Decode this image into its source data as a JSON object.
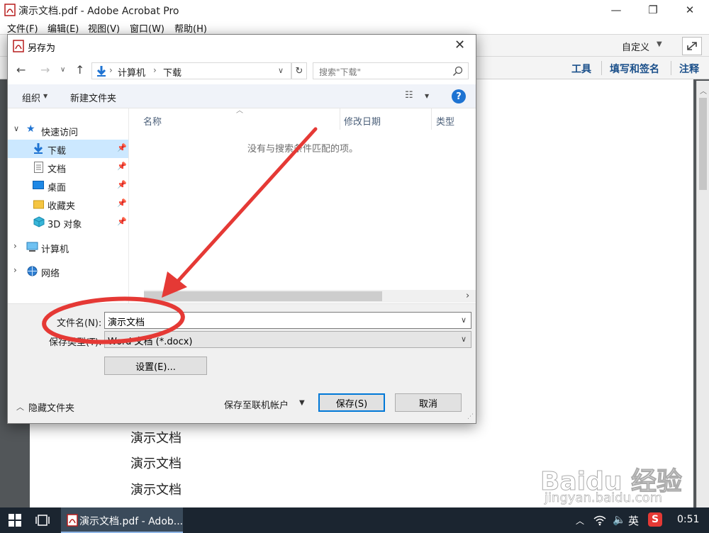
{
  "app": {
    "title": "演示文档.pdf - Adobe Acrobat Pro",
    "menu": [
      "文件(F)",
      "编辑(E)",
      "视图(V)",
      "窗口(W)",
      "帮助(H)"
    ],
    "toolbar_customize": "自定义",
    "panel_links": [
      "工具",
      "填写和签名",
      "注释"
    ]
  },
  "document": {
    "lines": [
      "演示文档",
      "演示文档",
      "演示文档"
    ]
  },
  "dialog": {
    "title": "另存为",
    "breadcrumb": [
      "计算机",
      "下载"
    ],
    "search_placeholder": "搜索\"下载\"",
    "organize_label": "组织",
    "new_folder_label": "新建文件夹",
    "nav": {
      "quick_access": "快速访问",
      "items": [
        "下载",
        "文档",
        "桌面",
        "收藏夹",
        "3D 对象"
      ],
      "computer": "计算机",
      "network": "网络"
    },
    "columns": [
      "名称",
      "修改日期",
      "类型"
    ],
    "empty_message": "没有与搜索条件匹配的项。",
    "filename_label": "文件名(N):",
    "filename_value": "演示文档",
    "filetype_label": "保存类型(T):",
    "filetype_value": "Word 文档 (*.docx)",
    "settings_button": "设置(E)...",
    "hide_folders": "隐藏文件夹",
    "save_online": "保存至联机帐户",
    "save_button": "保存(S)",
    "cancel_button": "取消"
  },
  "taskbar": {
    "active_app": "演示文档.pdf - Adob...",
    "ime": "英",
    "clock": "0:51"
  },
  "watermark": {
    "brand": "Baidu 经验",
    "url": "jingyan.baidu.com"
  },
  "colors": {
    "accent": "#0078d7",
    "selection": "#cce8ff",
    "annotation": "#e53935",
    "taskbar": "#1b2530"
  }
}
